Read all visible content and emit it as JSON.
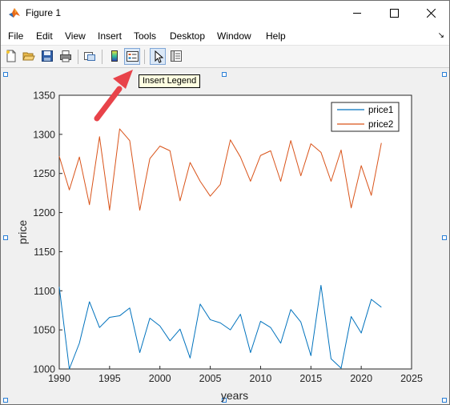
{
  "window": {
    "title": "Figure 1"
  },
  "menu": [
    "File",
    "Edit",
    "View",
    "Insert",
    "Tools",
    "Desktop",
    "Window",
    "Help"
  ],
  "menu_overflow_icon": "chevron-right-icon",
  "toolbar": {
    "buttons": [
      {
        "icon": "new-figure-icon"
      },
      {
        "icon": "open-file-icon"
      },
      {
        "icon": "save-icon"
      },
      {
        "icon": "print-icon"
      },
      {
        "icon": "link-plot-icon"
      },
      {
        "icon": "insert-colorbar-icon"
      },
      {
        "icon": "insert-legend-icon",
        "pressed": true
      },
      {
        "icon": "edit-plot-icon",
        "pressed": true
      },
      {
        "icon": "property-inspector-icon"
      }
    ],
    "tooltip": "Insert Legend"
  },
  "colors": {
    "series1": "#0072BD",
    "series2": "#D95319",
    "arrow": "#e8434a",
    "selection": "#2a7fd6"
  },
  "chart_data": {
    "type": "line",
    "xlabel": "years",
    "ylabel": "price",
    "xlim": [
      1990,
      2025
    ],
    "ylim": [
      1000,
      1350
    ],
    "xticks": [
      1990,
      1995,
      2000,
      2005,
      2010,
      2015,
      2020,
      2025
    ],
    "yticks": [
      1000,
      1050,
      1100,
      1150,
      1200,
      1250,
      1300,
      1350
    ],
    "legend_position": "top-right",
    "x": [
      1990,
      1991,
      1992,
      1993,
      1994,
      1995,
      1996,
      1997,
      1998,
      1999,
      2000,
      2001,
      2002,
      2003,
      2004,
      2005,
      2006,
      2007,
      2008,
      2009,
      2010,
      2011,
      2012,
      2013,
      2014,
      2015,
      2016,
      2017,
      2018,
      2019,
      2020,
      2021,
      2022
    ],
    "series": [
      {
        "name": "price1",
        "values": [
          1105,
          1000,
          1033,
          1086,
          1053,
          1066,
          1068,
          1078,
          1021,
          1065,
          1055,
          1036,
          1051,
          1014,
          1083,
          1063,
          1059,
          1050,
          1070,
          1021,
          1061,
          1053,
          1033,
          1076,
          1060,
          1017,
          1107,
          1013,
          1001,
          1067,
          1046,
          1089,
          1079
        ]
      },
      {
        "name": "price2",
        "values": [
          1272,
          1229,
          1271,
          1210,
          1297,
          1203,
          1307,
          1292,
          1203,
          1269,
          1285,
          1279,
          1215,
          1264,
          1240,
          1221,
          1236,
          1293,
          1271,
          1240,
          1273,
          1279,
          1240,
          1292,
          1247,
          1288,
          1277,
          1240,
          1280,
          1206,
          1260,
          1222,
          1289
        ]
      }
    ]
  }
}
